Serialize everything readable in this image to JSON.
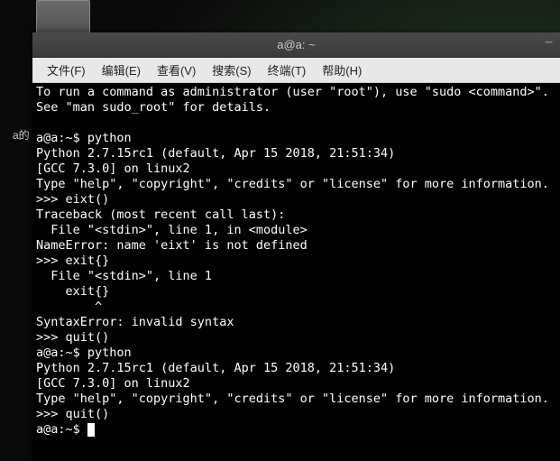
{
  "desktop": {
    "folder_label": "a的"
  },
  "window": {
    "title": "a@a: ~",
    "minimize": "–"
  },
  "menubar": {
    "file": "文件(F)",
    "edit": "编辑(E)",
    "view": "查看(V)",
    "search": "搜索(S)",
    "terminal": "终端(T)",
    "help": "帮助(H)"
  },
  "terminal": {
    "line01": "To run a command as administrator (user \"root\"), use \"sudo <command>\".",
    "line02": "See \"man sudo_root\" for details.",
    "line03": "",
    "line04": "a@a:~$ python",
    "line05": "Python 2.7.15rc1 (default, Apr 15 2018, 21:51:34)",
    "line06": "[GCC 7.3.0] on linux2",
    "line07": "Type \"help\", \"copyright\", \"credits\" or \"license\" for more information.",
    "line08": ">>> eixt()",
    "line09": "Traceback (most recent call last):",
    "line10": "  File \"<stdin>\", line 1, in <module>",
    "line11": "NameError: name 'eixt' is not defined",
    "line12": ">>> exit{}",
    "line13": "  File \"<stdin>\", line 1",
    "line14": "    exit{}",
    "line15": "        ^",
    "line16": "SyntaxError: invalid syntax",
    "line17": ">>> quit()",
    "line18": "a@a:~$ python",
    "line19": "Python 2.7.15rc1 (default, Apr 15 2018, 21:51:34)",
    "line20": "[GCC 7.3.0] on linux2",
    "line21": "Type \"help\", \"copyright\", \"credits\" or \"license\" for more information.",
    "line22": ">>> quit()",
    "line23": "a@a:~$ "
  }
}
